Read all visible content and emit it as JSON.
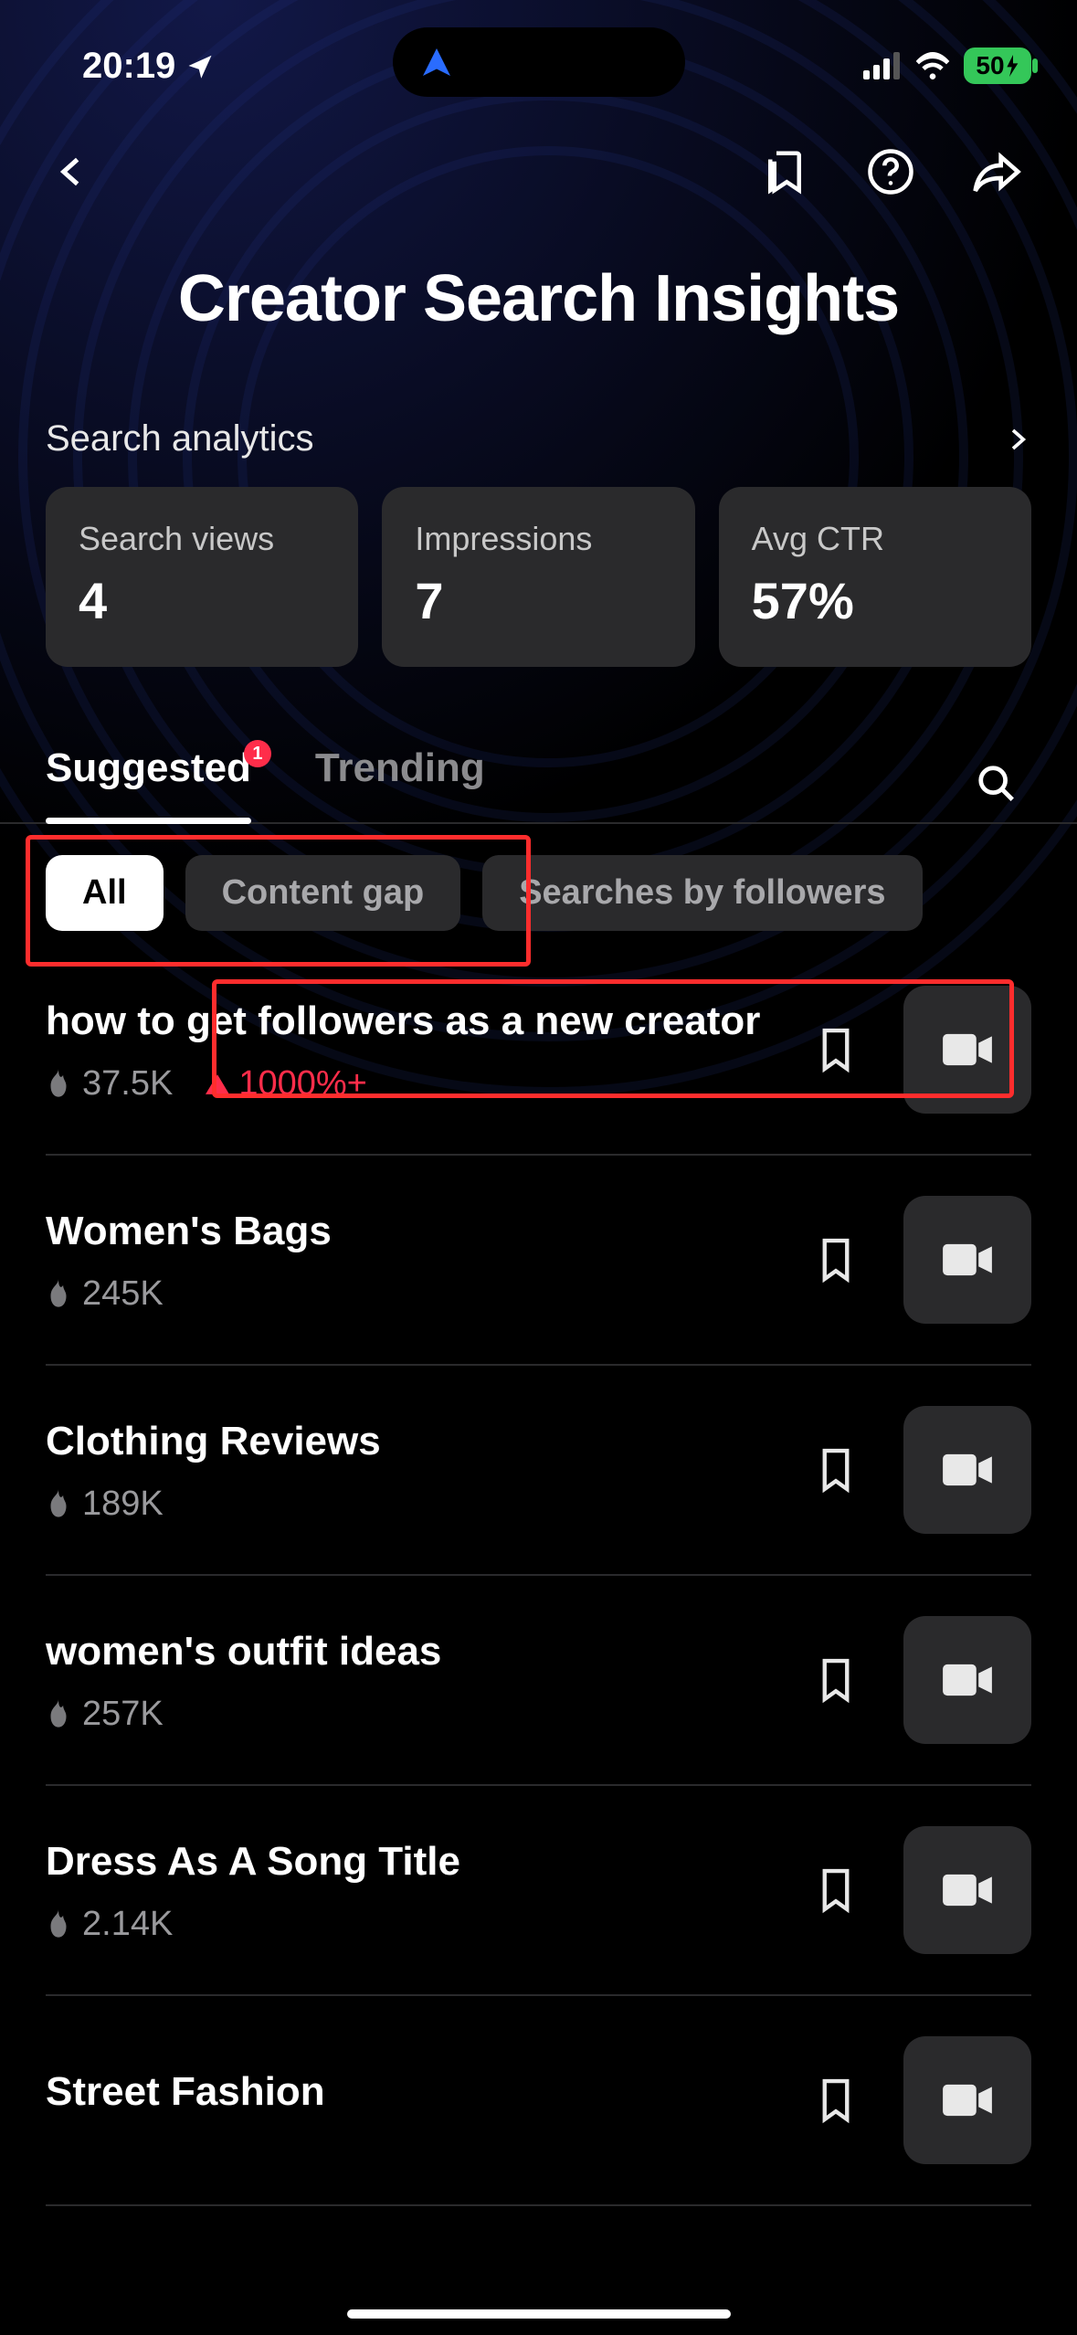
{
  "status": {
    "time": "20:19",
    "battery": "50"
  },
  "title": "Creator Search Insights",
  "analytics": {
    "section_label": "Search analytics",
    "cards": [
      {
        "label": "Search views",
        "value": "4"
      },
      {
        "label": "Impressions",
        "value": "7"
      },
      {
        "label": "Avg CTR",
        "value": "57%"
      }
    ]
  },
  "tabs": {
    "items": [
      {
        "label": "Suggested",
        "active": true,
        "badge": "1"
      },
      {
        "label": "Trending",
        "active": false
      }
    ]
  },
  "filters": {
    "items": [
      {
        "label": "All",
        "active": true
      },
      {
        "label": "Content gap",
        "active": false
      },
      {
        "label": "Searches by followers",
        "active": false
      }
    ]
  },
  "results": [
    {
      "title": "how to get followers as a new creator",
      "count": "37.5K",
      "trend": "1000%+"
    },
    {
      "title": "Women's Bags",
      "count": "245K"
    },
    {
      "title": "Clothing Reviews",
      "count": "189K"
    },
    {
      "title": "women's outfit ideas",
      "count": "257K"
    },
    {
      "title": "Dress As A Song Title",
      "count": "2.14K"
    },
    {
      "title": "Street Fashion",
      "count": ""
    }
  ]
}
